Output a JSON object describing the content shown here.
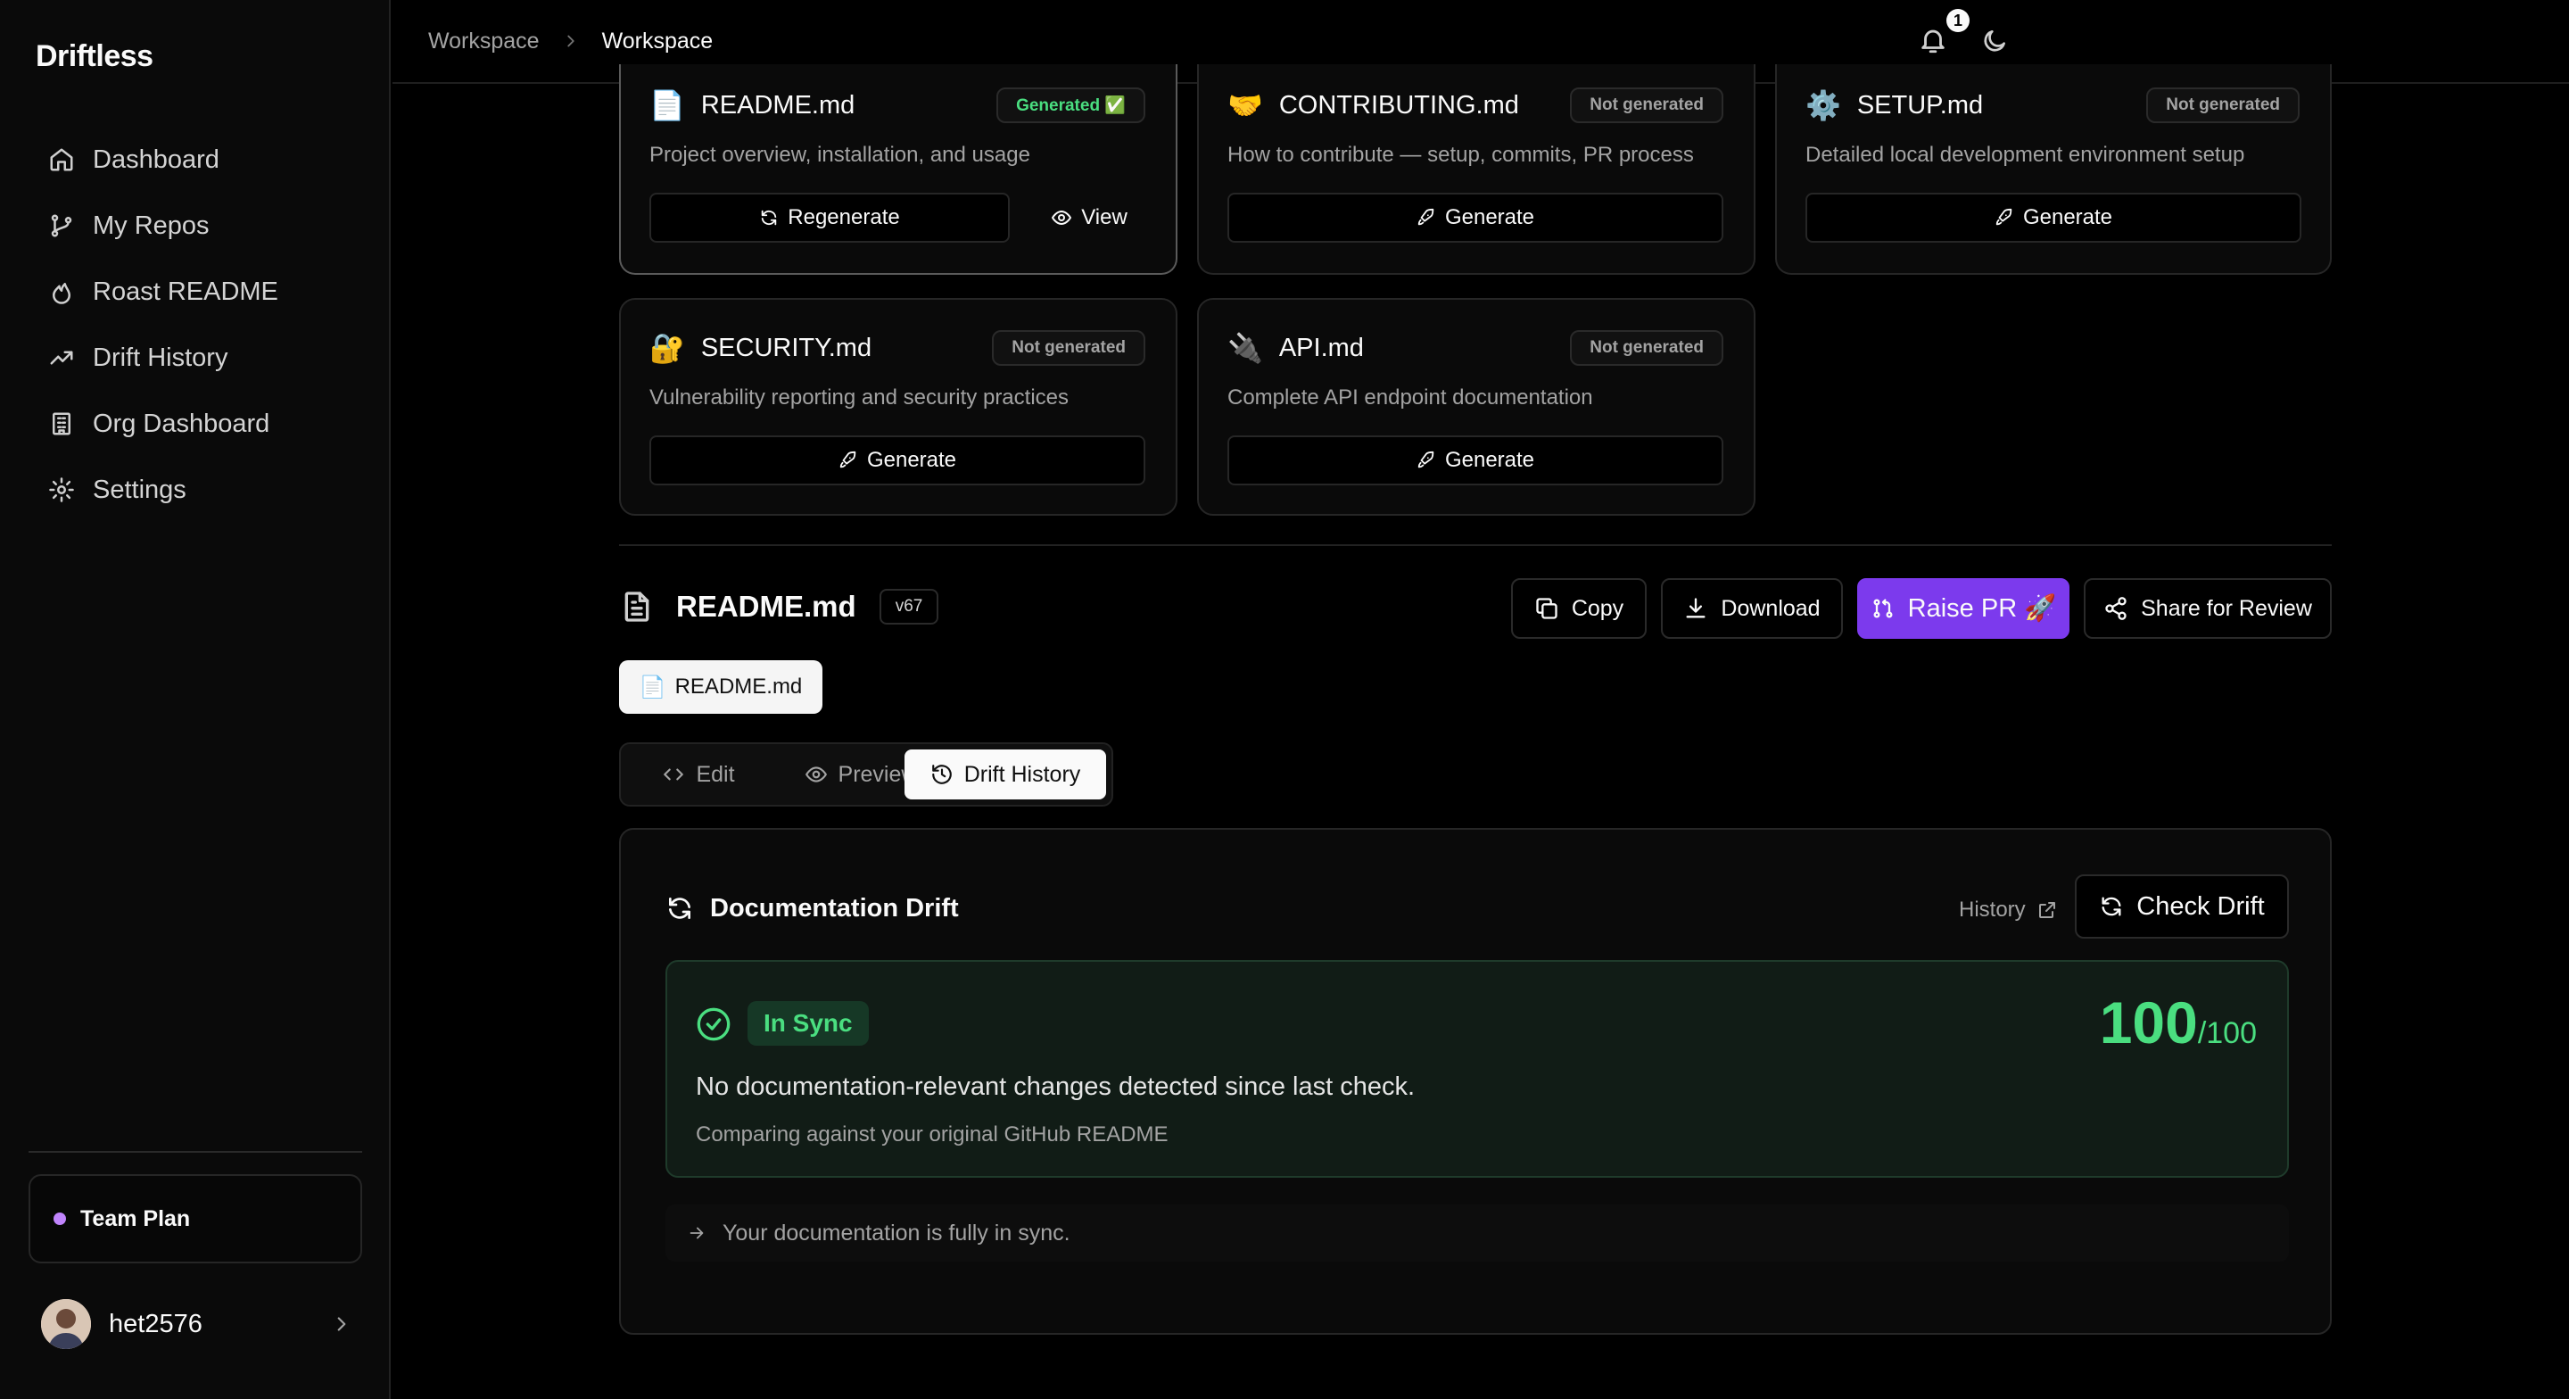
{
  "app": {
    "brand": "Driftless"
  },
  "sidebar": {
    "items": [
      {
        "label": "Dashboard",
        "icon": "home-icon"
      },
      {
        "label": "My Repos",
        "icon": "git-branch-icon"
      },
      {
        "label": "Roast README",
        "icon": "flame-icon"
      },
      {
        "label": "Drift History",
        "icon": "trending-up-icon"
      },
      {
        "label": "Org Dashboard",
        "icon": "building-icon"
      },
      {
        "label": "Settings",
        "icon": "gear-icon"
      }
    ],
    "plan": "Team Plan",
    "user": "het2576"
  },
  "topbar": {
    "breadcrumb": [
      "Workspace",
      "Workspace"
    ],
    "notifications": "1"
  },
  "docs": [
    {
      "emoji": "📄",
      "title": "README.md",
      "status": "Generated ✅",
      "desc": "Project overview, installation, and usage",
      "primary": "Regenerate",
      "secondary": "View"
    },
    {
      "emoji": "🤝",
      "title": "CONTRIBUTING.md",
      "status": "Not generated",
      "desc": "How to contribute — setup, commits, PR process",
      "primary": "Generate"
    },
    {
      "emoji": "⚙️",
      "title": "SETUP.md",
      "status": "Not generated",
      "desc": "Detailed local development environment setup",
      "primary": "Generate"
    },
    {
      "emoji": "🔐",
      "title": "SECURITY.md",
      "status": "Not generated",
      "desc": "Vulnerability reporting and security practices",
      "primary": "Generate"
    },
    {
      "emoji": "🔌",
      "title": "API.md",
      "status": "Not generated",
      "desc": "Complete API endpoint documentation",
      "primary": "Generate"
    }
  ],
  "file": {
    "title": "README.md",
    "version": "v67",
    "actions": {
      "copy": "Copy",
      "download": "Download",
      "raise_pr": "Raise PR 🚀",
      "share": "Share for Review"
    },
    "pill_emoji": "📄",
    "pill": "README.md"
  },
  "tabs": {
    "edit": "Edit",
    "preview": "Preview",
    "history": "Drift History"
  },
  "drift": {
    "title": "Documentation Drift",
    "history_link": "History",
    "check_button": "Check Drift",
    "status": "In Sync",
    "score": "100",
    "score_max": "/100",
    "message": "No documentation-relevant changes detected since last check.",
    "sub": "Comparing against your original GitHub README",
    "note": "Your documentation is fully in sync."
  },
  "colors": {
    "accent": "#7c3aed",
    "success": "#4ade80",
    "plan_dot": "#c084fc"
  }
}
